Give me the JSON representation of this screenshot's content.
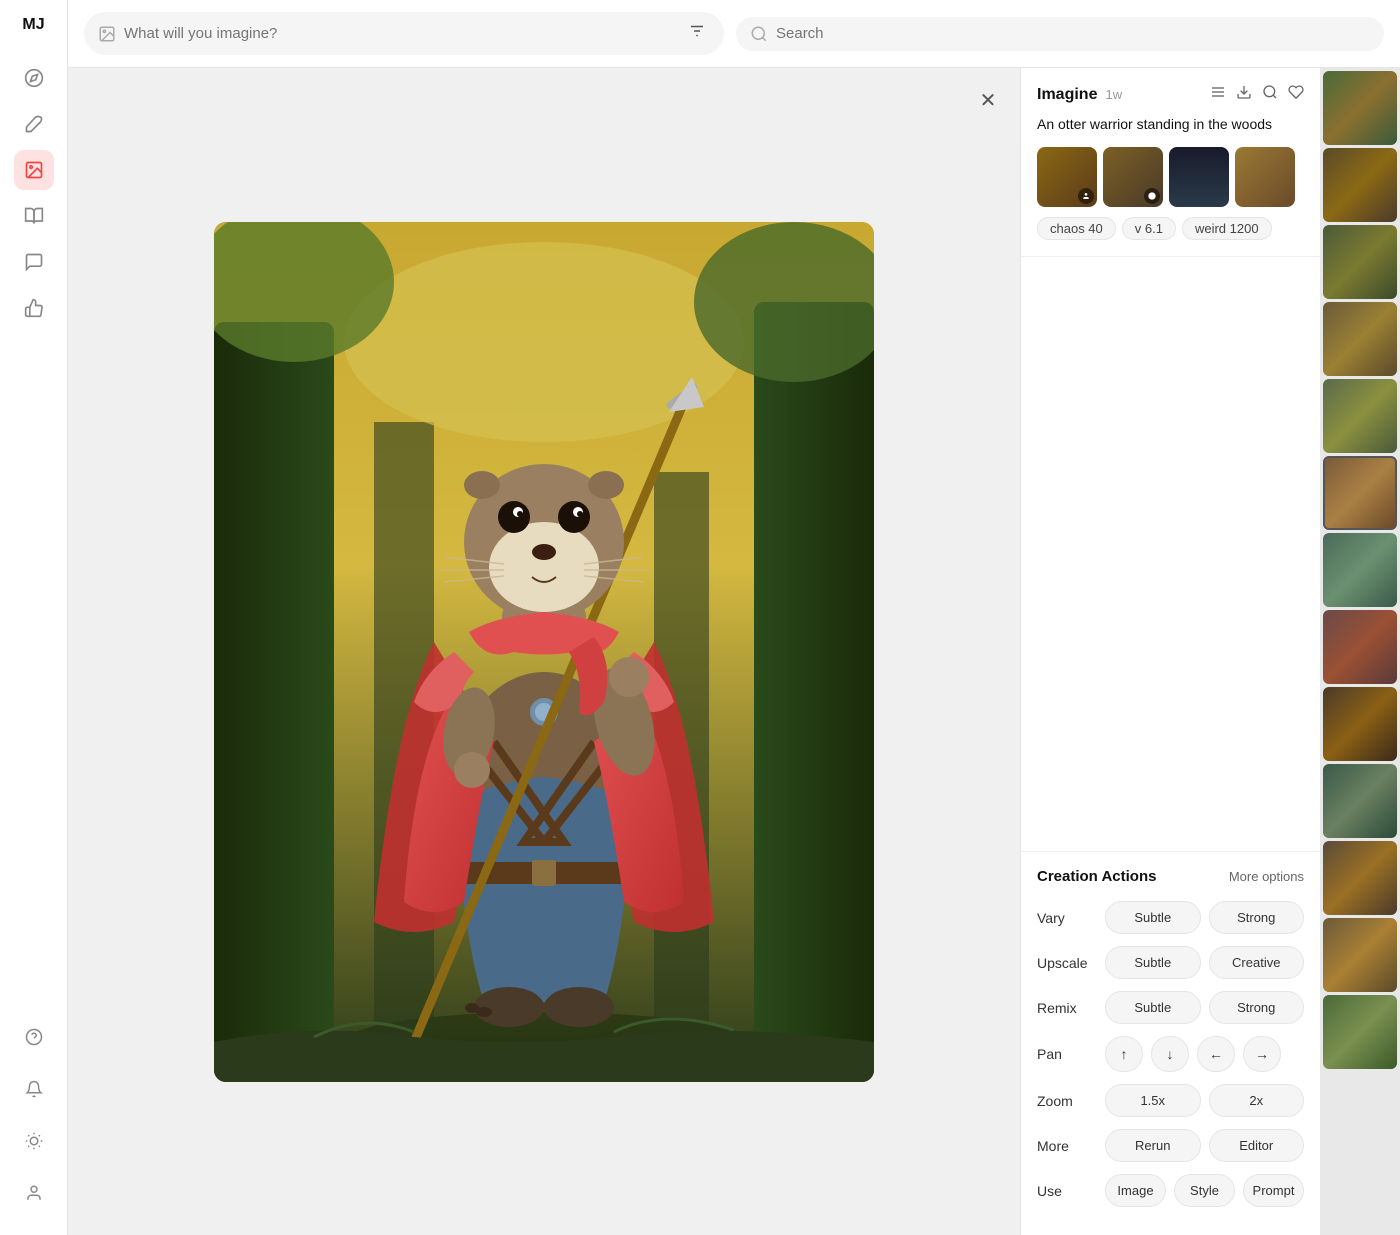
{
  "app": {
    "logo": "MJ"
  },
  "sidebar": {
    "icons": [
      {
        "name": "compass-icon",
        "symbol": "◎",
        "active": false
      },
      {
        "name": "brush-icon",
        "symbol": "🖌",
        "active": false
      },
      {
        "name": "image-icon",
        "symbol": "🖼",
        "active": true
      },
      {
        "name": "book-icon",
        "symbol": "📋",
        "active": false
      },
      {
        "name": "chat-icon",
        "symbol": "💬",
        "active": false
      },
      {
        "name": "thumb-icon",
        "symbol": "👍",
        "active": false
      }
    ],
    "bottom_icons": [
      {
        "name": "help-icon",
        "symbol": "?"
      },
      {
        "name": "bell-icon",
        "symbol": "🔔"
      },
      {
        "name": "sun-icon",
        "symbol": "☀"
      },
      {
        "name": "user-icon",
        "symbol": "👤"
      }
    ]
  },
  "topbar": {
    "search_placeholder": "What will you imagine?",
    "global_search_placeholder": "Search"
  },
  "detail": {
    "title": "Imagine",
    "time": "1w",
    "prompt_text": "An otter warrior standing in the woods",
    "tags": [
      {
        "label": "chaos 40"
      },
      {
        "label": "v 6.1"
      },
      {
        "label": "weird 1200"
      }
    ]
  },
  "creation_actions": {
    "title": "Creation Actions",
    "more_options": "More options",
    "rows": [
      {
        "label": "Vary",
        "buttons": [
          "Subtle",
          "Strong"
        ]
      },
      {
        "label": "Upscale",
        "buttons": [
          "Subtle",
          "Creative"
        ]
      },
      {
        "label": "Remix",
        "buttons": [
          "Subtle",
          "Strong"
        ]
      },
      {
        "label": "Pan",
        "pan_buttons": [
          "↑",
          "↓",
          "←",
          "→"
        ]
      },
      {
        "label": "Zoom",
        "buttons": [
          "1.5x",
          "2x"
        ]
      },
      {
        "label": "More",
        "buttons": [
          "Rerun",
          "Editor"
        ]
      },
      {
        "label": "Use",
        "buttons": [
          "Image",
          "Style",
          "Prompt"
        ]
      }
    ]
  },
  "strip_colors": [
    {
      "bg": "linear-gradient(135deg, #4a6a3a 0%, #8B7030 50%, #3a5a3a 100%)"
    },
    {
      "bg": "linear-gradient(135deg, #5a4a2a 0%, #8B6914 50%, #4a3a2a 100%)"
    },
    {
      "bg": "linear-gradient(180deg, #1a1a2a 0%, #2a3a4a 100%)"
    },
    {
      "bg": "linear-gradient(135deg, #6a4a2a 0%, #9B7934 50%, #5a4a2a 100%)"
    },
    {
      "bg": "linear-gradient(135deg, #4a5a3a 0%, #7B8030 50%, #3a4a2a 100%)"
    },
    {
      "bg": "linear-gradient(135deg, #5a6a4a 0%, #8B9040 50%, #4a5a3a 100%)"
    },
    {
      "bg": "linear-gradient(135deg, #6a5a3a 0%, #9B8034 50%, #5a4a2a 100%)"
    },
    {
      "bg": "linear-gradient(135deg, #4a3a2a 0%, #8B6014 50%, #3a2a1a 100%)"
    },
    {
      "bg": "linear-gradient(135deg, #5a4a3a 0%, #9B7024 50%, #4a3a2a 100%)"
    },
    {
      "bg": "linear-gradient(135deg, #3a5a4a 0%, #6B8060 50%, #2a4a3a 100%)"
    },
    {
      "bg": "linear-gradient(135deg, #6a4a4a 0%, #9B5034 50%, #5a3a3a 100%)"
    },
    {
      "bg": "linear-gradient(135deg, #4a6a5a 0%, #6B9070 50%, #3a5a4a 100%)"
    },
    {
      "bg": "linear-gradient(135deg, #7a5a3a 0%, #AA8044 50%, #6a4a2a 100%)"
    }
  ]
}
